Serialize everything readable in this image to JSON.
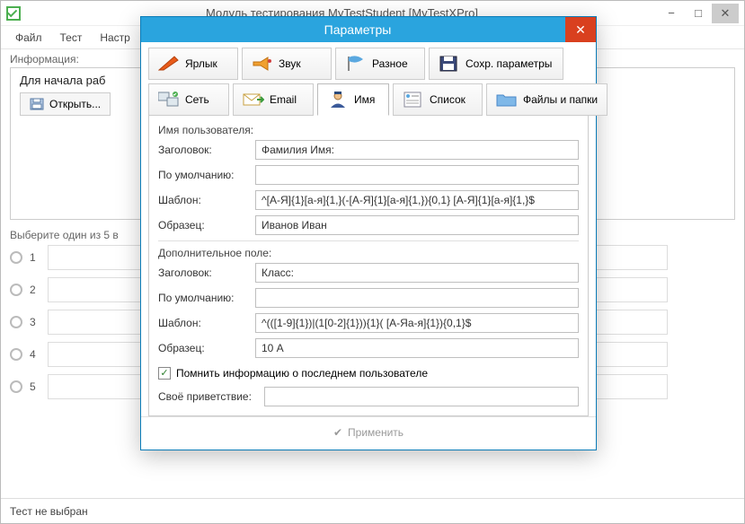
{
  "mainWindow": {
    "title": "Модуль тестирования MyTestStudent [MyTestXPro]",
    "menu": {
      "file": "Файл",
      "test": "Тест",
      "settings": "Настр"
    },
    "infoLabel": "Информация:",
    "infoText": "Для начала раб",
    "openBtn": "Открыть...",
    "variantsLabel": "Выберите один из 5 в",
    "variants": [
      "1",
      "2",
      "3",
      "4",
      "5"
    ],
    "status": "Тест не выбран"
  },
  "dialog": {
    "title": "Параметры",
    "toolbar1": {
      "shortcut": "Ярлык",
      "sound": "Звук",
      "misc": "Разное",
      "save": "Сохр. параметры"
    },
    "toolbar2": {
      "network": "Сеть",
      "email": "Email",
      "name": "Имя",
      "list": "Список",
      "files": "Файлы и папки"
    },
    "userGroup": "Имя пользователя:",
    "headerLabel": "Заголовок:",
    "defaultLabel": "По умолчанию:",
    "patternLabel": "Шаблон:",
    "sampleLabel": "Образец:",
    "user": {
      "header": "Фамилия Имя:",
      "defaultVal": "",
      "pattern": "^[А-Я]{1}[а-я]{1,}(-[А-Я]{1}[а-я]{1,}){0,1} [А-Я]{1}[а-я]{1,}$",
      "sample": "Иванов Иван"
    },
    "extraGroup": "Дополнительное поле:",
    "extra": {
      "header": "Класс:",
      "defaultVal": "",
      "pattern": "^(([1-9]{1})|(1[0-2]{1})){1}( [А-Яа-я]{1}){0,1}$",
      "sample": "10 А"
    },
    "rememberLabel": "Помнить информацию о последнем пользователе",
    "greetingLabel": "Своё приветствие:",
    "greetingVal": "",
    "applyLabel": "Применить"
  }
}
